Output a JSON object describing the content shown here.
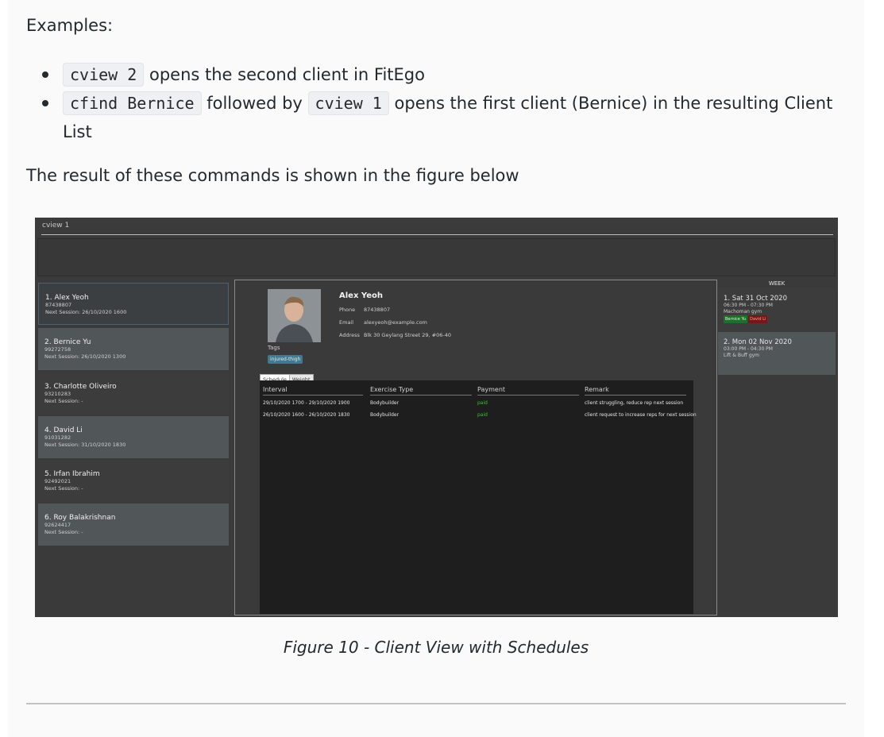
{
  "examples_heading": "Examples:",
  "bullets": [
    {
      "code1": "cview 2",
      "text1": "opens the second client in FitEgo"
    },
    {
      "code1": "cfind Bernice",
      "text1": "followed by",
      "code2": "cview 1",
      "text2": "opens the first client (Bernice) in the resulting Client List"
    }
  ],
  "result_text": "The result of these commands is shown in the figure below",
  "app": {
    "command": "cview 1",
    "clients": [
      {
        "name": "1.  Alex Yeoh",
        "phone": "87438807",
        "session": "Next Session: 26/10/2020 1600"
      },
      {
        "name": "2.  Bernice Yu",
        "phone": "99272758",
        "session": "Next Session: 26/10/2020 1300"
      },
      {
        "name": "3.  Charlotte Oliveiro",
        "phone": "93210283",
        "session": "Next Session:  -"
      },
      {
        "name": "4.  David Li",
        "phone": "91031282",
        "session": "Next Session: 31/10/2020 1830"
      },
      {
        "name": "5.  Irfan Ibrahim",
        "phone": "92492021",
        "session": "Next Session:  -"
      },
      {
        "name": "6.  Roy Balakrishnan",
        "phone": "92624417",
        "session": "Next Session:  -"
      }
    ],
    "detail": {
      "name": "Alex Yeoh",
      "phone_label": "Phone",
      "phone": "87438807",
      "email_label": "Email",
      "email": "alexyeoh@example.com",
      "address_label": "Address",
      "address": "Blk 30 Geylang Street 29, #06-40",
      "tags_label": "Tags",
      "tag": "injured-thigh",
      "tabs": [
        "Schedule",
        "Weight"
      ],
      "columns": [
        "Interval",
        "Exercise Type",
        "Payment",
        "Remark"
      ],
      "rows": [
        {
          "interval": "29/10/2020 1700 - 29/10/2020 1900",
          "type": "Bodybuilder",
          "payment": "paid",
          "remark": "client struggling, reduce rep next session"
        },
        {
          "interval": "26/10/2020 1600 - 26/10/2020 1830",
          "type": "Bodybuilder",
          "payment": "paid",
          "remark": "client request to increase reps for next session"
        }
      ]
    },
    "week": {
      "title": "WEEK",
      "items": [
        {
          "date": "1.  Sat 31 Oct 2020",
          "time": "06:30 PM - 07:30 PM",
          "place": "Machoman gym",
          "tags": [
            "Bernice Yu",
            "David Li"
          ]
        },
        {
          "date": "2.  Mon 02 Nov 2020",
          "time": "03:00 PM - 04:30 PM",
          "place": "Lift & Buff gym"
        }
      ]
    }
  },
  "caption": "Figure 10 - Client View with Schedules"
}
